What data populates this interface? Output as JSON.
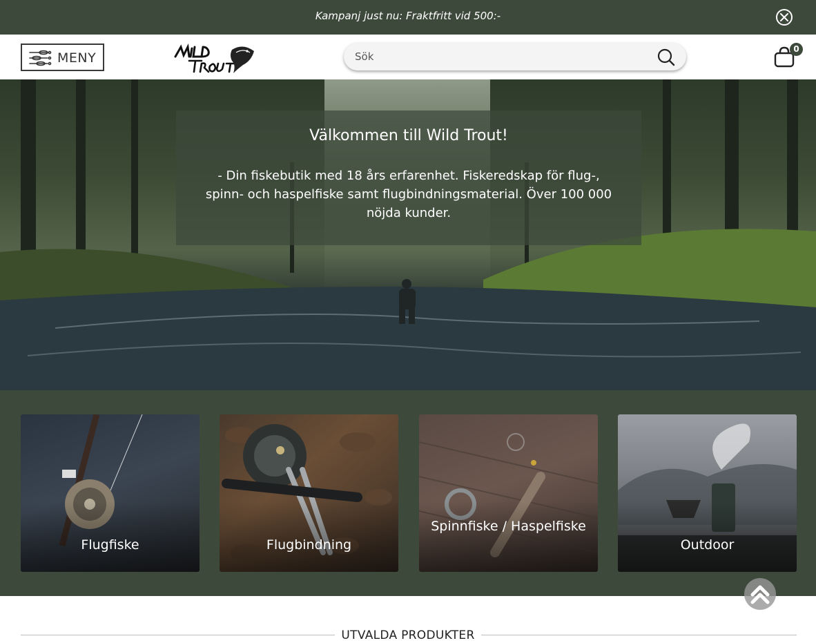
{
  "promo": {
    "text": "Kampanj just nu: Fraktfritt vid 500:-",
    "close_icon": "close-circle-icon"
  },
  "header": {
    "menu_label": "MENY",
    "menu_icon": "fishing-lures-menu-icon",
    "logo_alt": "Wild Trout",
    "search_placeholder": "Sök",
    "search_icon": "search-icon",
    "cart_icon": "shopping-bag-icon",
    "cart_count": "0"
  },
  "hero": {
    "title": "Välkommen till Wild Trout!",
    "text": "- Din fiskebutik med 18 års erfarenhet. Fiskeredskap för flug-, spinn- och haspelfiske samt flugbindningsmaterial. Över 100 000 nöjda kunder."
  },
  "categories": [
    {
      "label": "Flugfiske"
    },
    {
      "label": "Flugbindning"
    },
    {
      "label": "Spinnfiske / Haspelfiske"
    },
    {
      "label": "Outdoor"
    }
  ],
  "featured": {
    "title": "UTVALDA PRODUKTER"
  },
  "colors": {
    "brand_green": "#3d4a3b",
    "white": "#ffffff"
  }
}
